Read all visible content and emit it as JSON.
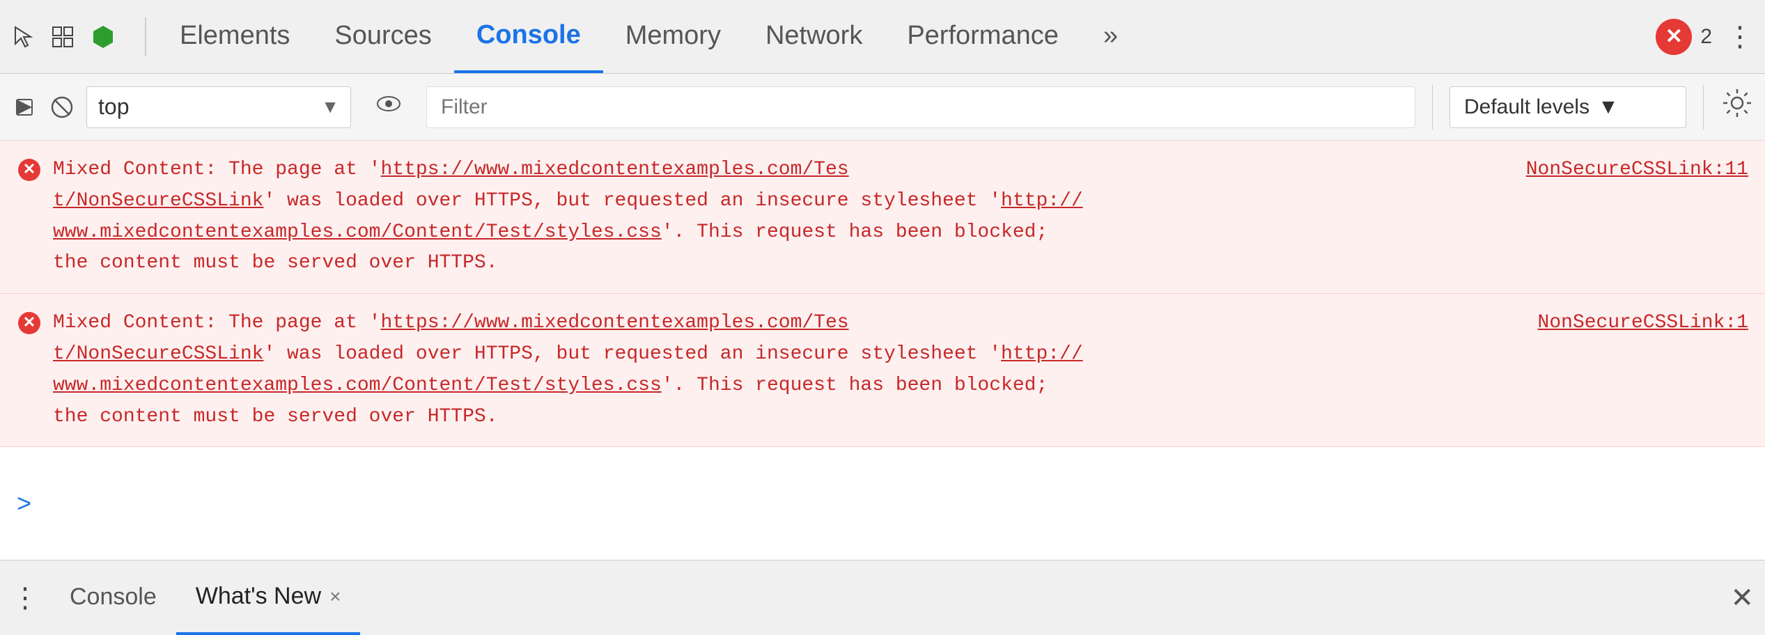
{
  "toolbar": {
    "tabs": [
      {
        "label": "Elements",
        "active": false
      },
      {
        "label": "Sources",
        "active": false
      },
      {
        "label": "Console",
        "active": true
      },
      {
        "label": "Memory",
        "active": false
      },
      {
        "label": "Network",
        "active": false
      },
      {
        "label": "Performance",
        "active": false
      }
    ],
    "more_tabs_label": "»",
    "error_count": "2",
    "more_options_label": "⋮"
  },
  "second_toolbar": {
    "context_selector": "top",
    "context_selector_placeholder": "top",
    "filter_placeholder": "Filter",
    "levels_label": "Default levels",
    "levels_arrow": "▼"
  },
  "console": {
    "errors": [
      {
        "id": "error-1",
        "source_link": "NonSecureCSSLink:11",
        "source_link2": "t/NonSecureCSSLink",
        "message_line1": "Mixed Content: The page at 'https://www.mixedcontentexamples.com/Tes",
        "message_line2": "t/NonSecureCSSLink' was loaded over HTTPS, but requested an insecure stylesheet 'http://",
        "message_line3": "www.mixedcontentexamples.com/Content/Test/styles.css'. This request has been blocked;",
        "message_line4": "the content must be served over HTTPS."
      },
      {
        "id": "error-2",
        "source_link": "NonSecureCSSLink:1",
        "source_link2": "t/NonSecureCSSLink",
        "message_line1": "Mixed Content: The page at 'https://www.mixedcontentexamples.com/Tes",
        "message_line2": "t/NonSecureCSSLink' was loaded over HTTPS, but requested an insecure stylesheet 'http://",
        "message_line3": "www.mixedcontentexamples.com/Content/Test/styles.css'. This request has been blocked;",
        "message_line4": "the content must be served over HTTPS."
      }
    ],
    "prompt_symbol": ">"
  },
  "bottom_bar": {
    "more_label": "⋮",
    "tabs": [
      {
        "label": "Console",
        "active": false
      },
      {
        "label": "What's New",
        "active": true
      }
    ],
    "close_label": "✕"
  },
  "icons": {
    "cursor": "⬡",
    "layers": "⬜",
    "hexagon": "⬡",
    "play": "▶",
    "block": "⊘",
    "eye": "👁",
    "gear": "⚙",
    "error_circle": "✖"
  }
}
